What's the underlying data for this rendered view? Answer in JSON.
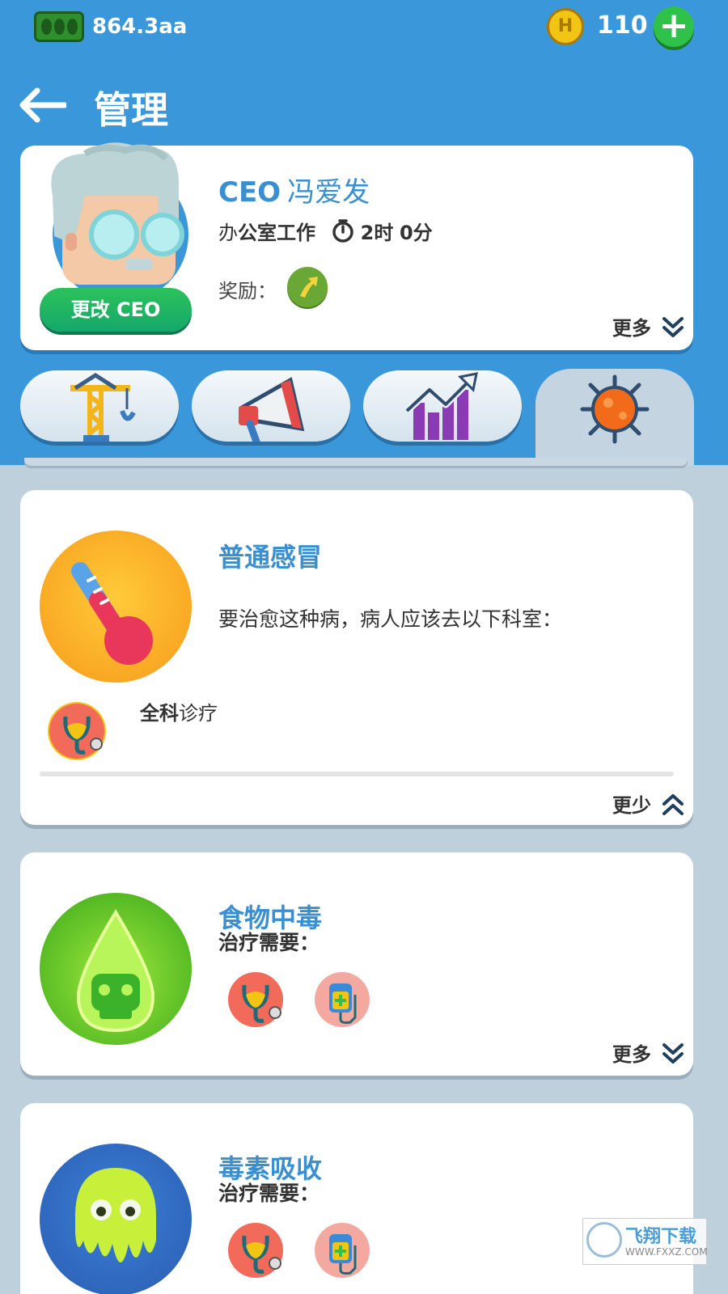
{
  "status": {
    "cash": "864.3aa",
    "coins": "110",
    "coin_symbol": "H",
    "add_label": "+"
  },
  "header": {
    "title": "管理"
  },
  "ceo": {
    "prefix": "CEO",
    "name": "冯爱发",
    "work_prefix": "办",
    "work_bold": "公室工作",
    "time_hours": "2时",
    "time_minutes": "0分",
    "reward_label": "奖励：",
    "change_button": "更改 CEO",
    "more_label": "更多"
  },
  "tabs": [
    {
      "icon": "crane-icon"
    },
    {
      "icon": "megaphone-icon"
    },
    {
      "icon": "chart-icon"
    },
    {
      "icon": "virus-icon",
      "active": true
    }
  ],
  "diseases": [
    {
      "title": "普通感冒",
      "description": "要治愈这种病，病人应该去以下科室：",
      "room_bold": "全科",
      "room_rest": "诊疗",
      "toggle_label": "更少",
      "expanded": true
    },
    {
      "title": "食物中毒",
      "need_label": "治疗需要：",
      "toggle_label": "更多",
      "rooms": [
        "stethoscope-icon",
        "iv-drip-icon"
      ]
    },
    {
      "title": "毒素吸收",
      "need_label": "治疗需要：",
      "rooms": [
        "stethoscope-icon",
        "iv-drip-icon"
      ]
    }
  ],
  "watermark": {
    "text": "飞翔下载",
    "url": "WWW.FXXZ.COM"
  },
  "colors": {
    "header_blue": "#3a98da",
    "title_blue": "#3a8fd0",
    "button_green": "#2ec24a",
    "background": "#bed0dc"
  }
}
